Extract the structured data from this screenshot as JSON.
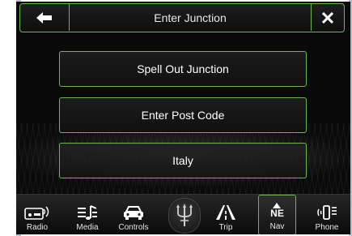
{
  "header": {
    "title": "Enter Junction",
    "back_icon": "back-arrow-icon",
    "close_icon": "close-icon"
  },
  "menu": {
    "items": [
      {
        "label": "Spell Out Junction"
      },
      {
        "label": "Enter Post Code"
      },
      {
        "label": "Italy"
      }
    ]
  },
  "tabbar": {
    "tabs": [
      {
        "label": "Radio",
        "icon": "radio-icon"
      },
      {
        "label": "Media",
        "icon": "media-icon"
      },
      {
        "label": "Controls",
        "icon": "car-icon"
      },
      {
        "label": "Trip",
        "icon": "road-icon"
      },
      {
        "label": "Nav",
        "icon": "compass-icon",
        "direction": "NE",
        "active": true
      },
      {
        "label": "Phone",
        "icon": "phone-icon"
      }
    ],
    "logo_icon": "trident-logo-icon"
  },
  "colors": {
    "accent": "#6db84a",
    "background": "#0a0a0a",
    "text": "#ffffff"
  }
}
